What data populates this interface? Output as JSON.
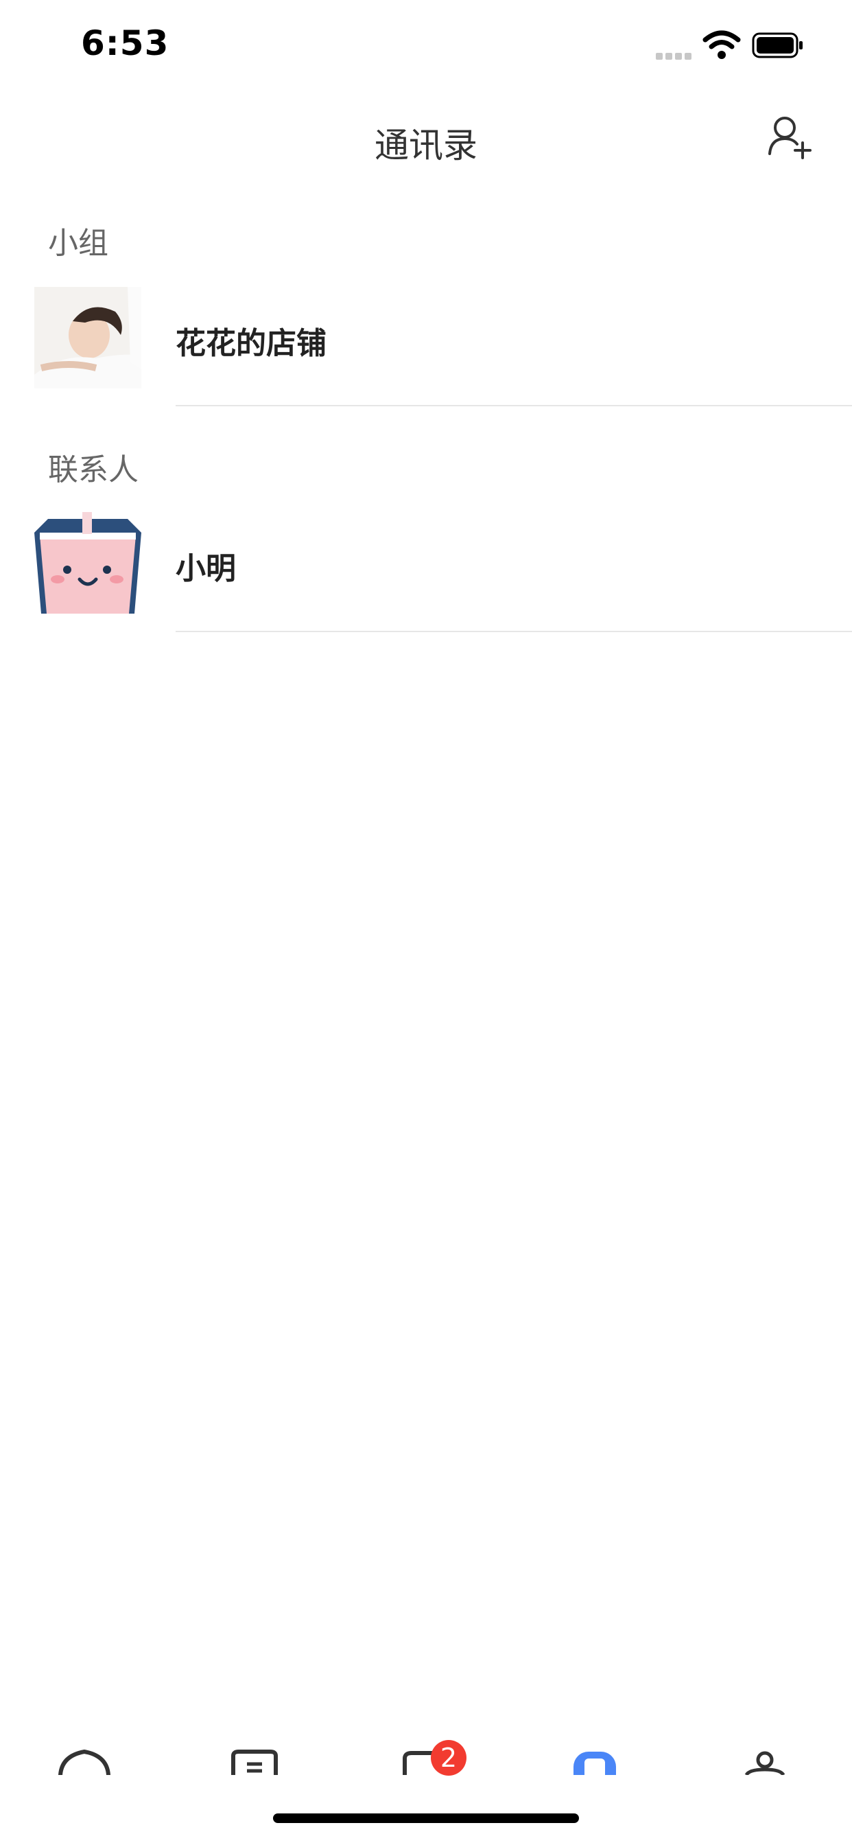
{
  "status_bar": {
    "time": "6:53"
  },
  "header": {
    "title": "通讯录",
    "action_icon": "add-contact-icon"
  },
  "sections": [
    {
      "label": "小组",
      "items": [
        {
          "name": "花花的店铺",
          "avatar": "woman-photo"
        }
      ]
    },
    {
      "label": "联系人",
      "items": [
        {
          "name": "小明",
          "avatar": "pink-cup-sticker"
        }
      ]
    }
  ],
  "tabbar": {
    "tabs": [
      {
        "icon": "home-icon"
      },
      {
        "icon": "shop-icon"
      },
      {
        "icon": "message-icon",
        "badge": "2"
      },
      {
        "icon": "contacts-icon",
        "active": true
      },
      {
        "icon": "profile-icon"
      }
    ],
    "active_color": "#4a86f7"
  }
}
